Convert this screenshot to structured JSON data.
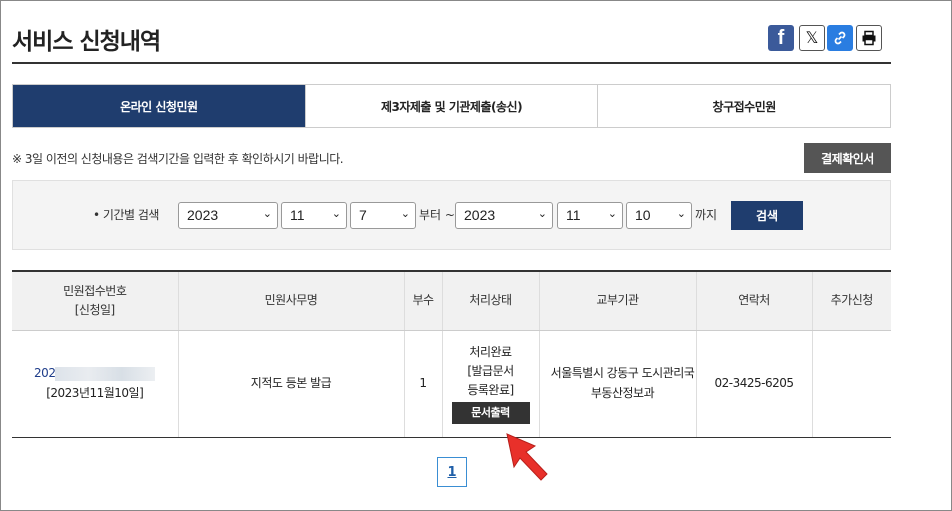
{
  "page": {
    "title": "서비스 신청내역"
  },
  "share": {
    "facebook_icon": "f",
    "x_icon": "𝕏"
  },
  "tabs": [
    {
      "label": "온라인 신청민원",
      "active": true
    },
    {
      "label": "제3자제출 및 기관제출(송신)",
      "active": false
    },
    {
      "label": "창구접수민원",
      "active": false
    }
  ],
  "notice": "※ 3일 이전의 신청내용은 검색기간을 입력한 후 확인하시기 바랍니다.",
  "receipt_button": "결제확인서",
  "search": {
    "label": "기간별 검색",
    "from": {
      "year": "2023",
      "month": "11",
      "day": "7"
    },
    "from_suffix": "부터 ~",
    "to": {
      "year": "2023",
      "month": "11",
      "day": "10"
    },
    "to_suffix": "까지",
    "button": "검색"
  },
  "table": {
    "headers": {
      "app_no": "민원접수번호",
      "app_no_sub": "[신청일]",
      "name": "민원사무명",
      "copies": "부수",
      "status": "처리상태",
      "office": "교부기관",
      "contact": "연락처",
      "extra": "추가신청"
    },
    "rows": [
      {
        "app_no": "202",
        "date": "[2023년11월10일]",
        "name": "지적도 등본 발급",
        "copies": "1",
        "status_line1": "처리완료",
        "status_line2": "[발급문서",
        "status_line3": "등록완료]",
        "print_button": "문서출력",
        "office_line1": "서울특별시 강동구 도시관리국",
        "office_line2": "부동산정보과",
        "contact": "02-3425-6205",
        "extra": ""
      }
    ]
  },
  "pagination": {
    "current": "1"
  },
  "colors": {
    "primary": "#1f3d6e",
    "dark_button": "#555555",
    "arrow": "#e8302a"
  }
}
